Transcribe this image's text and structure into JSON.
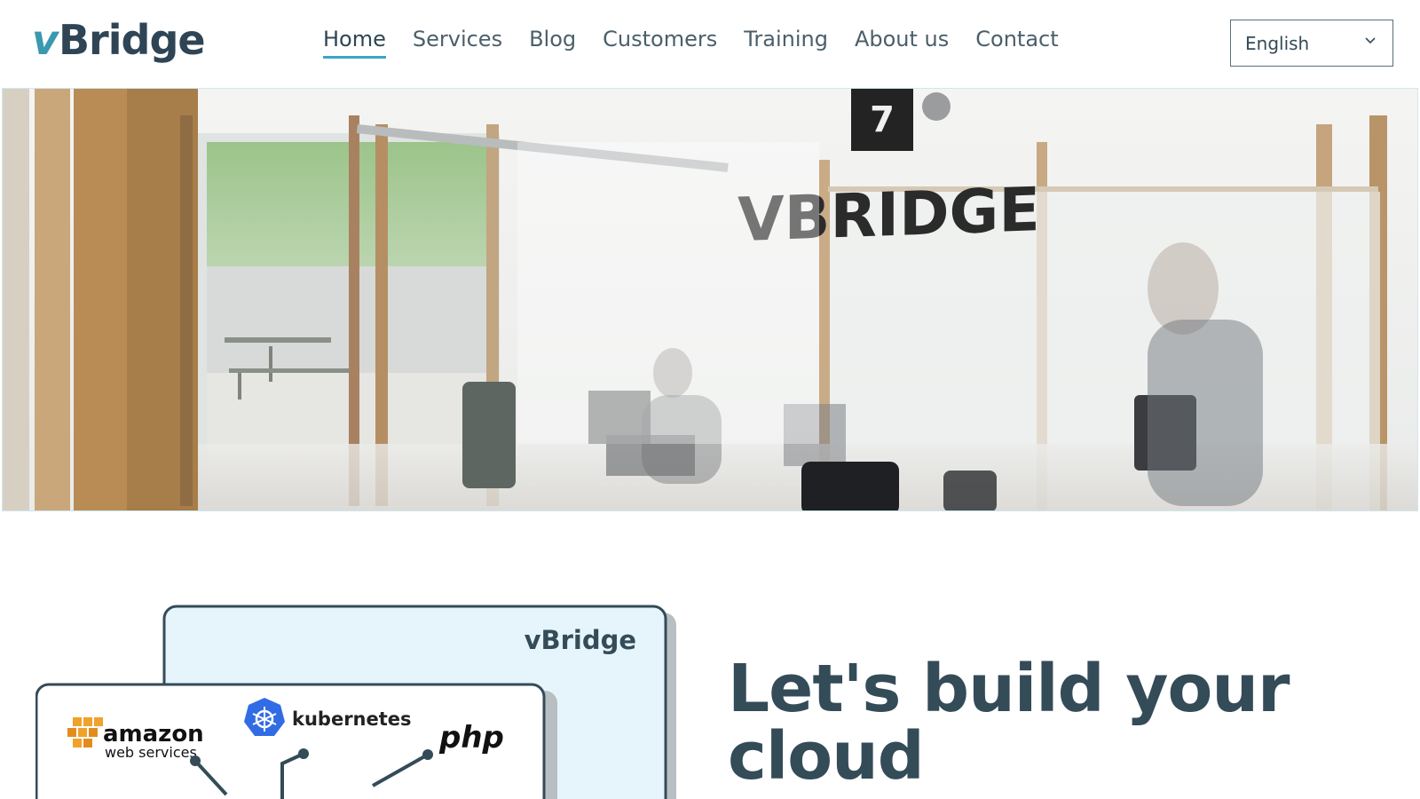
{
  "header": {
    "logo_v": "v",
    "logo_rest": "Bridge",
    "nav": [
      {
        "label": "Home",
        "active": true
      },
      {
        "label": "Services",
        "active": false
      },
      {
        "label": "Blog",
        "active": false
      },
      {
        "label": "Customers",
        "active": false
      },
      {
        "label": "Training",
        "active": false
      },
      {
        "label": "About us",
        "active": false
      },
      {
        "label": "Contact",
        "active": false
      }
    ],
    "language": {
      "selected": "English",
      "icon": "chevron-down-icon"
    }
  },
  "hero": {
    "room_number": "7",
    "wall_sign": "VBRIDGE"
  },
  "illustration": {
    "brand_label": "vBridge",
    "logos": {
      "amazon_line1": "amazon",
      "amazon_line2": "web services",
      "kubernetes": "kubernetes",
      "php": "php"
    }
  },
  "main": {
    "headline_line1": "Let's build your",
    "headline_line2": "cloud"
  },
  "colors": {
    "accent": "#3aa6c8",
    "text_dark": "#344b58",
    "card_bg": "#e6f5fc"
  }
}
